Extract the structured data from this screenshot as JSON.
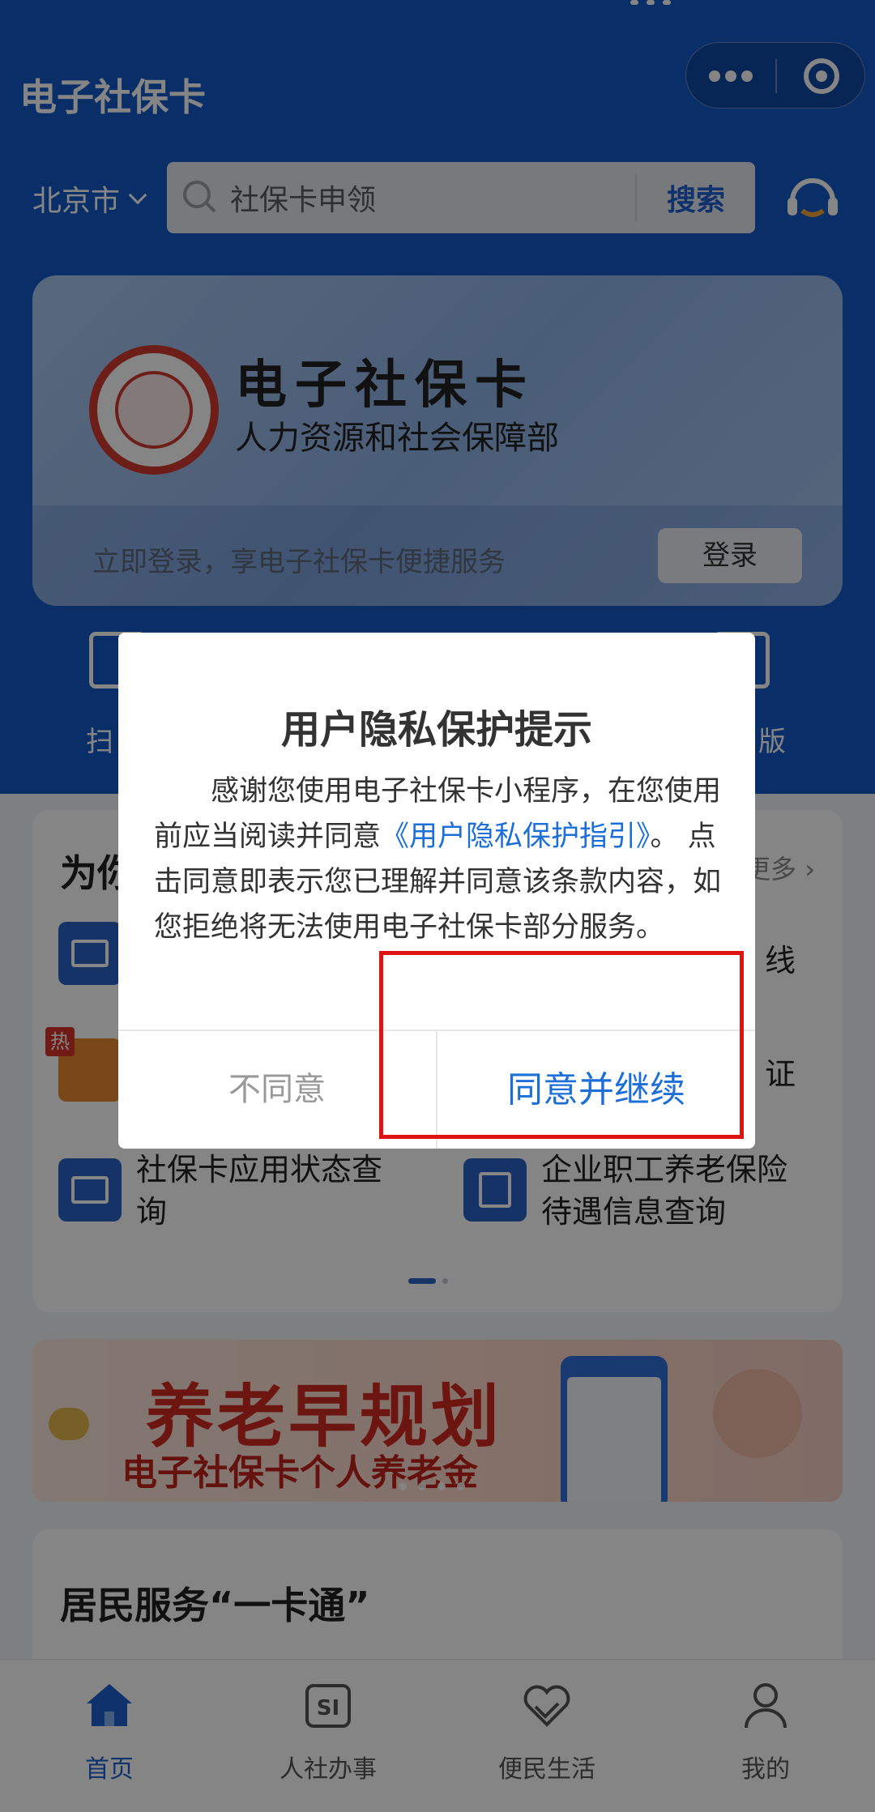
{
  "header": {
    "app_title": "电子社保卡",
    "city": "北京市",
    "search_placeholder": "社保卡申领",
    "search_button": "搜索"
  },
  "card": {
    "title": "电子社保卡",
    "subtitle": "人力资源和社会保障部",
    "login_hint": "立即登录，享电子社保卡便捷服务",
    "login_button": "登录"
  },
  "quick_actions": {
    "left_partial": "扫",
    "right_partial": "版"
  },
  "services": {
    "title_partial": "为你",
    "more": "更多 ›",
    "items": [
      {
        "label": "社保卡应用状态查询",
        "label_line1": "社保卡应用状态查",
        "label_line2": "询"
      },
      {
        "label": "企业职工养老保险待遇信息查询",
        "label_line1": "企业职工养老保险",
        "label_line2": "待遇信息查询"
      },
      {
        "label_partial_right_1": "线"
      },
      {
        "label_partial_right_2": "证"
      }
    ],
    "hot_badge": "热"
  },
  "promo": {
    "title": "养老早规划",
    "subtitle": "电子社保卡个人养老金"
  },
  "resident": {
    "title": "居民服务“一卡通”"
  },
  "tabbar": {
    "tabs": [
      {
        "label": "首页",
        "icon": "home-icon",
        "active": true
      },
      {
        "label": "人社办事",
        "icon": "si-icon",
        "active": false
      },
      {
        "label": "便民生活",
        "icon": "heart-hand-icon",
        "active": false
      },
      {
        "label": "我的",
        "icon": "user-icon",
        "active": false
      }
    ]
  },
  "modal": {
    "title": "用户隐私保护提示",
    "body_part1": "感谢您使用电子社保卡小程序，在您使用前应当阅读并同意",
    "body_link": "《用户隐私保护指引》",
    "body_part2": "。 点击同意即表示您已理解并同意该条款内容，如您拒绝将无法使用电子社保卡部分服务。",
    "disagree": "不同意",
    "agree": "同意并继续"
  },
  "colors": {
    "brand_blue": "#1559c7",
    "link_blue": "#1d6fd8",
    "highlight_red": "#e01313"
  }
}
